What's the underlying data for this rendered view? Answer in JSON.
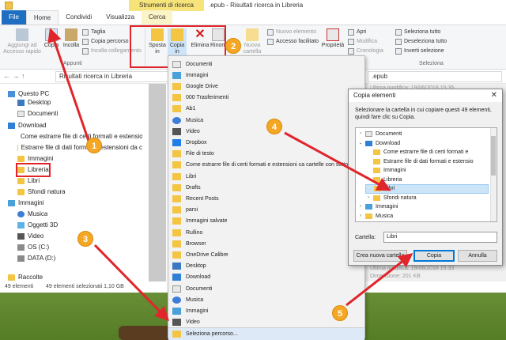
{
  "window": {
    "context_tab_header": "Strumenti di ricerca",
    "title": ".epub - Risultati ricerca in Libreria"
  },
  "tabs": [
    "File",
    "Home",
    "Condividi",
    "Visualizza",
    "Cerca"
  ],
  "ribbon": {
    "pin_label": "Aggiungi ad\nAccesso rapido",
    "copy_label": "Copia",
    "paste_label": "Incolla",
    "cut_label": "Taglia",
    "copy_path_label": "Copia percorso",
    "paste_shortcut_label": "Incolla collegamento",
    "clipboard_group": "Appunti",
    "move_label": "Sposta\nin",
    "copy_to_label": "Copia\nin",
    "delete_label": "Elimina",
    "rename_label": "Rinom",
    "new_folder_label": "Nuova\ncartella",
    "new_item_label": "Nuovo elemento",
    "easy_access_label": "Accesso facilitato",
    "properties_label": "Proprietà",
    "open_label": "Apri",
    "edit_label": "Modifica",
    "history_label": "Cronologia",
    "select_all_label": "Seleziona tutto",
    "deselect_all_label": "Deseleziona tutto",
    "invert_selection_label": "Inverti selezione",
    "select_group": "Seleziona"
  },
  "addressbar": {
    "path": "Risultati ricerca in Libreria",
    "search": ".epub"
  },
  "navpane": [
    {
      "label": "Questo PC",
      "icon": "pc"
    },
    {
      "label": "Desktop",
      "icon": "desk"
    },
    {
      "label": "Documenti",
      "icon": "doc"
    },
    {
      "label": "Download",
      "icon": "down"
    },
    {
      "label": "Come estrarre file di certi formati e estensio",
      "icon": "folder"
    },
    {
      "label": "Estrarre file di dati formati e estensioni da c",
      "icon": "folder"
    },
    {
      "label": "Immagini",
      "icon": "folder"
    },
    {
      "label": "Libreria",
      "icon": "folder"
    },
    {
      "label": "Libri",
      "icon": "folder"
    },
    {
      "label": "Sfondi natura",
      "icon": "folder"
    },
    {
      "label": "Immagini",
      "icon": "img"
    },
    {
      "label": "Musica",
      "icon": "music"
    },
    {
      "label": "Oggetti 3D",
      "icon": "obj"
    },
    {
      "label": "Video",
      "icon": "video"
    },
    {
      "label": "OS (C:)",
      "icon": "drive"
    },
    {
      "label": "DATA (D:)",
      "icon": "drive"
    },
    {
      "label": "Raccolte",
      "icon": "folder"
    }
  ],
  "details": {
    "modified_top": "Ultima modifica: 19/06/2018 15:35",
    "modified_bottom": "Ultima modifica: 19/06/2018 15:33",
    "size": "Dimensione: 201 KB"
  },
  "statusbar": {
    "count": "49 elementi",
    "selected": "49 elementi selezionati  1,10 GB"
  },
  "dropdown": [
    {
      "label": "Documenti",
      "icon": "doc"
    },
    {
      "label": "Immagini",
      "icon": "img"
    },
    {
      "label": "Google Drive",
      "icon": "folder"
    },
    {
      "label": "000 Trasferimenti",
      "icon": "folder"
    },
    {
      "label": "Ab1",
      "icon": "folder"
    },
    {
      "label": "Musica",
      "icon": "music"
    },
    {
      "label": "Video",
      "icon": "video"
    },
    {
      "label": "Dropbox",
      "icon": "dropbox"
    },
    {
      "label": "File di testo",
      "icon": "folder"
    },
    {
      "label": "Come estrarre file di certi formati e estensioni ca cartelle con sottocartelle",
      "icon": "folder"
    },
    {
      "label": "Libri",
      "icon": "folder"
    },
    {
      "label": "Drafts",
      "icon": "folder"
    },
    {
      "label": "Recent Posts",
      "icon": "folder"
    },
    {
      "label": "parsi",
      "icon": "folder"
    },
    {
      "label": "Immagini salvate",
      "icon": "folder"
    },
    {
      "label": "Rullino",
      "icon": "folder"
    },
    {
      "label": "Browser",
      "icon": "folder"
    },
    {
      "label": "OneDrive Calibre",
      "icon": "folder"
    },
    {
      "label": "Desktop",
      "icon": "desk"
    },
    {
      "label": "Download",
      "icon": "down"
    },
    {
      "label": "Documenti",
      "icon": "doc"
    },
    {
      "label": "Musica",
      "icon": "music"
    },
    {
      "label": "Immagini",
      "icon": "img"
    },
    {
      "label": "Video",
      "icon": "video"
    },
    {
      "label": "Seleziona percorso...",
      "icon": "folder"
    }
  ],
  "dialog": {
    "title": "Copia elementi",
    "description": "Selezionare la cartella in cui copiare questi 49 elementi, quindi fare clic su Copia.",
    "tree": [
      {
        "label": "Documenti",
        "icon": "doc",
        "indent": 1,
        "chev": "›"
      },
      {
        "label": "Download",
        "icon": "down",
        "indent": 1,
        "chev": "⌄"
      },
      {
        "label": "Come estrarre file di certi formati e",
        "icon": "folder",
        "indent": 2,
        "chev": ""
      },
      {
        "label": "Estrarre file di dati formati e estensio",
        "icon": "folder",
        "indent": 2,
        "chev": ""
      },
      {
        "label": "Immagini",
        "icon": "folder",
        "indent": 2,
        "chev": ""
      },
      {
        "label": "Libreria",
        "icon": "folder",
        "indent": 2,
        "chev": ""
      },
      {
        "label": "Libri",
        "icon": "folder",
        "indent": 2,
        "chev": "",
        "selected": true
      },
      {
        "label": "Sfondi natura",
        "icon": "folder",
        "indent": 2,
        "chev": "›"
      },
      {
        "label": "Immagini",
        "icon": "img",
        "indent": 1,
        "chev": "›"
      },
      {
        "label": "Musica",
        "icon": "folder",
        "indent": 1,
        "chev": "›"
      }
    ],
    "folder_label": "Cartella:",
    "folder_value": "Libri",
    "new_folder_button": "Crea nuova cartella",
    "copy_button": "Copia",
    "cancel_button": "Annulla"
  },
  "annotations": {
    "badges": [
      "1",
      "2",
      "3",
      "4",
      "5"
    ],
    "colors": {
      "arrow": "#e0252b",
      "badge": "#f5a623"
    }
  }
}
